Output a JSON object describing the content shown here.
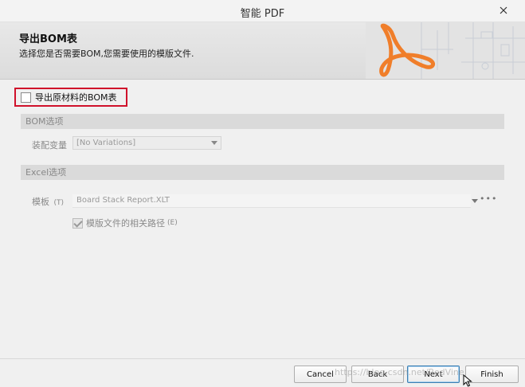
{
  "window": {
    "title": "智能 PDF"
  },
  "header": {
    "title": "导出BOM表",
    "subtitle": "选择您是否需要BOM,您需要使用的模版文件."
  },
  "export_bom": {
    "label": "导出原材料的BOM表",
    "checked": false
  },
  "bom_section": {
    "title": "BOM选项",
    "variant_label": "装配变量",
    "variant_value": "[No Variations]"
  },
  "excel_section": {
    "title": "Excel选项",
    "template_label": "模板",
    "template_shortcut": "(T)",
    "template_value": "Board Stack Report.XLT",
    "relative_path_label": "模版文件的相关路径",
    "relative_path_shortcut": "(E)",
    "relative_path_checked": true
  },
  "footer": {
    "cancel": "Cancel",
    "back": "Back",
    "next": "Next",
    "finish": "Finish",
    "watermark": "https://blog.csdn.net/RedVine"
  },
  "colors": {
    "highlight_border": "#d0112b",
    "logo_orange": "#f07e2a"
  }
}
